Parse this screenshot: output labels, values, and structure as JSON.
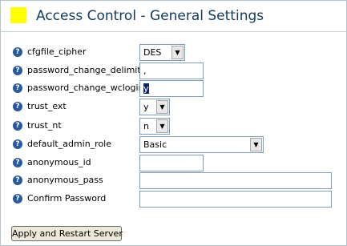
{
  "header": {
    "title": "Access Control - General Settings",
    "swatch_color": "#ffff00"
  },
  "help_icon_glyph": "?",
  "fields": {
    "cfgfile_cipher": {
      "label": "cfgfile_cipher",
      "value": "DES"
    },
    "password_change_delimiter": {
      "label": "password_change_delimiter",
      "value": ","
    },
    "password_change_wclogin": {
      "label": "password_change_wclogin",
      "value": "y"
    },
    "trust_ext": {
      "label": "trust_ext",
      "value": "y"
    },
    "trust_nt": {
      "label": "trust_nt",
      "value": "n"
    },
    "default_admin_role": {
      "label": "default_admin_role",
      "value": "Basic"
    },
    "anonymous_id": {
      "label": "anonymous_id",
      "value": ""
    },
    "anonymous_pass": {
      "label": "anonymous_pass",
      "value": ""
    },
    "confirm_password": {
      "label": "Confirm Password",
      "value": ""
    }
  },
  "actions": {
    "apply_label": "Apply and Restart Server"
  }
}
